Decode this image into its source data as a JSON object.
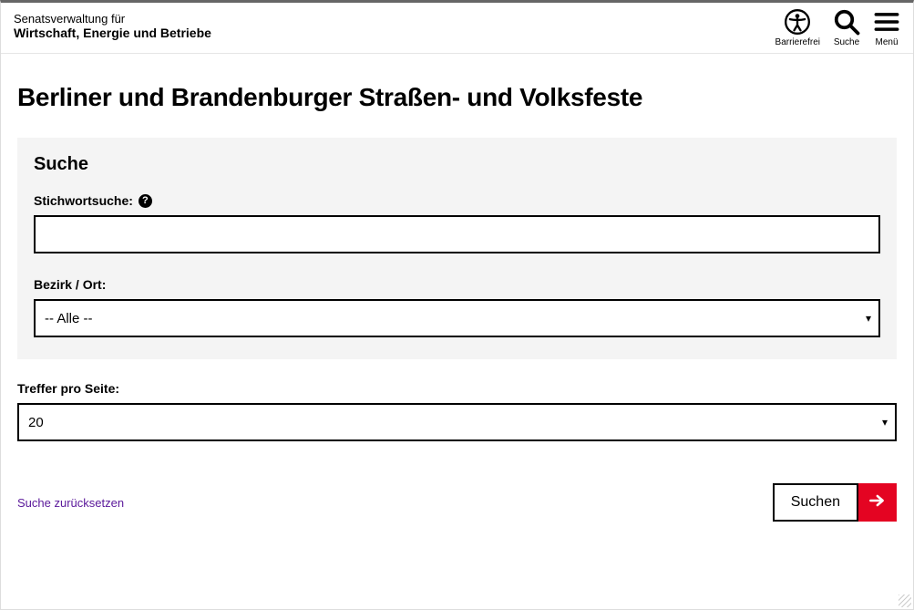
{
  "header": {
    "org_line1": "Senatsverwaltung für",
    "org_line2": "Wirtschaft, Energie und Betriebe",
    "buttons": {
      "accessibility": "Barrierefrei",
      "search": "Suche",
      "menu": "Menü"
    }
  },
  "page": {
    "title": "Berliner und Brandenburger Straßen- und Volksfeste"
  },
  "search_panel": {
    "heading": "Suche",
    "keyword_label": "Stichwortsuche:",
    "keyword_value": "",
    "help_symbol": "?",
    "district_label": "Bezirk / Ort:",
    "district_selected": "-- Alle --"
  },
  "results_per_page": {
    "label": "Treffer pro Seite:",
    "selected": "20"
  },
  "actions": {
    "reset": "Suche zurücksetzen",
    "submit": "Suchen"
  }
}
